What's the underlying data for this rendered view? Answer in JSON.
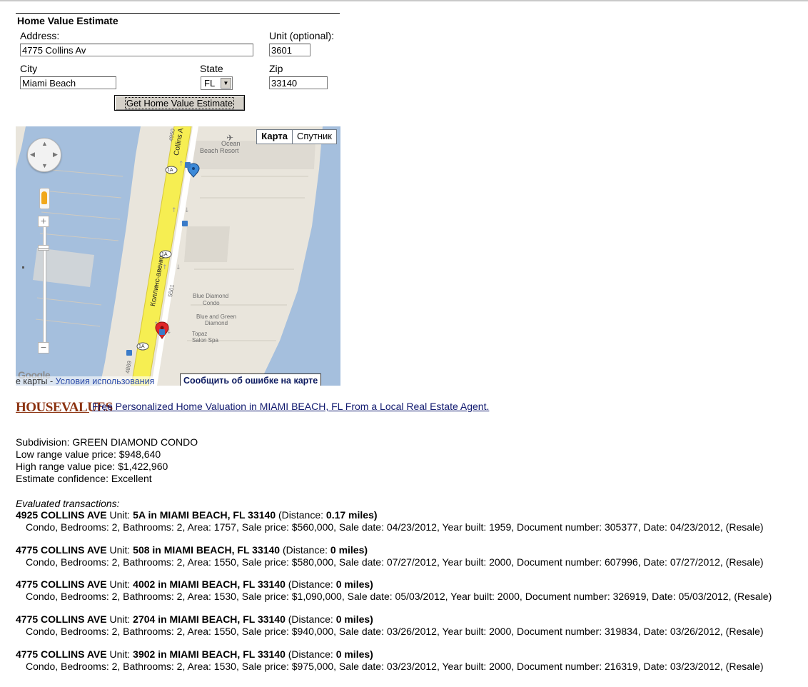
{
  "form": {
    "title": "Home Value Estimate",
    "address_label": "Address:",
    "address_value": "4775 Collins Av",
    "unit_label": "Unit (optional):",
    "unit_value": "3601",
    "city_label": "City",
    "city_value": "Miami Beach",
    "state_label": "State",
    "state_value": "FL",
    "zip_label": "Zip",
    "zip_value": "33140",
    "submit_label": "Get Home Value Estimate"
  },
  "map": {
    "type_map": "Карта",
    "type_satellite": "Спутник",
    "street_label": "Коллинс-авеню",
    "street_label_top": "Collins A",
    "route_shield": "1A",
    "place_ocean": "Ocean",
    "place_beach": "Beach Resort",
    "place_blue_diamond": "Blue Diamond",
    "place_condo": "Condo",
    "place_blue_green": "Blue and Green",
    "place_diamond": "Diamond",
    "place_topaz": "Topaz",
    "place_salon": "Salon Spa",
    "number_5501": "5501",
    "number_4869": "4869",
    "number_4950": "4950",
    "google_label": "Google",
    "attribution_prefix": "е карты - ",
    "terms_link": "Условия использования",
    "report_link": "Сообщить об ошибке на карте",
    "colors": {
      "water": "#a5bfdd",
      "land": "#e9e5dc",
      "road": "#f6ee52",
      "marker_red": "#e0262a",
      "marker_blue": "#3d8ad8"
    }
  },
  "housevalues": {
    "logo_house": "HOUSE",
    "logo_values": "VALUES",
    "link_text": "Free Personalized Home Valuation in MIAMI BEACH, FL From a Local Real Estate Agent."
  },
  "estimate": {
    "subdivision": "Subdivision: GREEN DIAMOND CONDO",
    "low": "Low range value price: $948,640",
    "high": "High range value pice: $1,422,960",
    "confidence": "Estimate confidence: Excellent"
  },
  "transactions_title": "Evaluated transactions:",
  "transactions": [
    {
      "street": "4925 COLLINS AVE",
      "unit_word": "Unit:",
      "unit_loc": "5A in MIAMI BEACH, FL 33140",
      "dist_label": "(Distance:",
      "dist_value": "0.17 miles)",
      "detail": "Condo, Bedrooms: 2, Bathrooms: 2, Area: 1757, Sale price: $560,000, Sale date: 04/23/2012, Year built: 1959, Document number: 305377, Date: 04/23/2012, (Resale)"
    },
    {
      "street": "4775 COLLINS AVE",
      "unit_word": "Unit:",
      "unit_loc": "508 in MIAMI BEACH, FL 33140",
      "dist_label": "(Distance:",
      "dist_value": "0 miles)",
      "detail": "Condo, Bedrooms: 2, Bathrooms: 2, Area: 1550, Sale price: $580,000, Sale date: 07/27/2012, Year built: 2000, Document number: 607996, Date: 07/27/2012, (Resale)"
    },
    {
      "street": "4775 COLLINS AVE",
      "unit_word": "Unit:",
      "unit_loc": "4002 in MIAMI BEACH, FL 33140",
      "dist_label": "(Distance:",
      "dist_value": "0 miles)",
      "detail": "Condo, Bedrooms: 2, Bathrooms: 2, Area: 1530, Sale price: $1,090,000, Sale date: 05/03/2012, Year built: 2000, Document number: 326919, Date: 05/03/2012, (Resale)"
    },
    {
      "street": "4775 COLLINS AVE",
      "unit_word": "Unit:",
      "unit_loc": "2704 in MIAMI BEACH, FL 33140",
      "dist_label": "(Distance:",
      "dist_value": "0 miles)",
      "detail": "Condo, Bedrooms: 2, Bathrooms: 2, Area: 1550, Sale price: $940,000, Sale date: 03/26/2012, Year built: 2000, Document number: 319834, Date: 03/26/2012, (Resale)"
    },
    {
      "street": "4775 COLLINS AVE",
      "unit_word": "Unit:",
      "unit_loc": "3902 in MIAMI BEACH, FL 33140",
      "dist_label": "(Distance:",
      "dist_value": "0 miles)",
      "detail": "Condo, Bedrooms: 2, Bathrooms: 2, Area: 1530, Sale price: $975,000, Sale date: 03/23/2012, Year built: 2000, Document number: 216319, Date: 03/23/2012, (Resale)"
    }
  ]
}
